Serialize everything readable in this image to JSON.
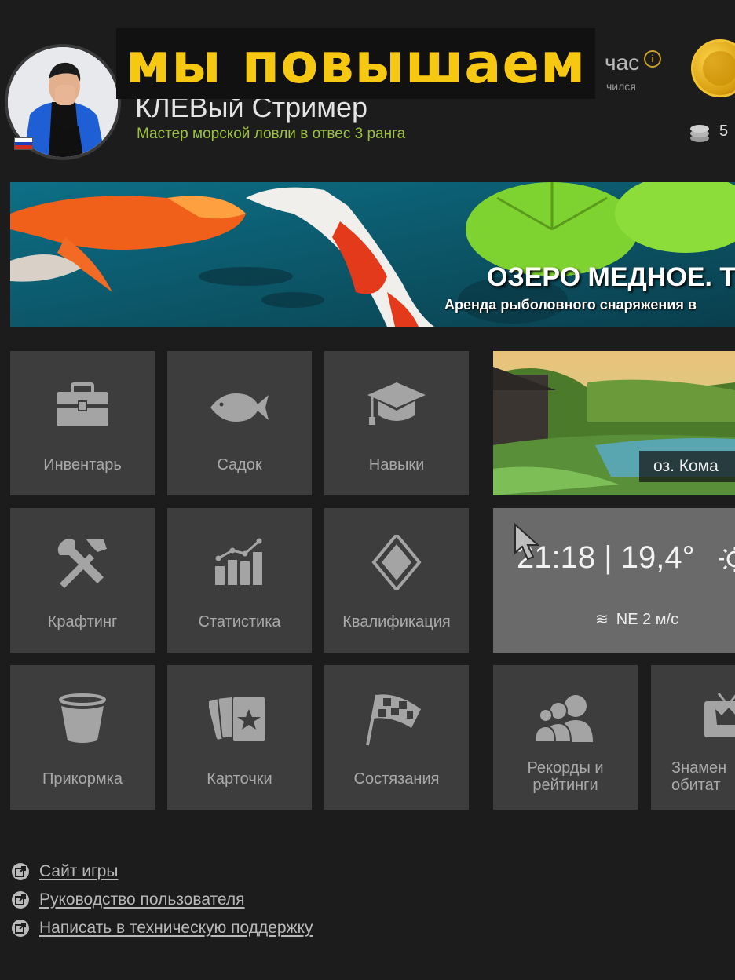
{
  "overlay": {
    "caption": "мы повышаем"
  },
  "header": {
    "status_text": "час",
    "status_subtext": "чился",
    "player": {
      "name": "КЛЕВый Стример",
      "rank": "Мастер морской ловли в отвес 3 ранга",
      "country_flag": [
        "#ffffff",
        "#1d3fbf",
        "#d52b1e"
      ]
    },
    "currency": {
      "gold_icon": "gold-coin-icon",
      "silver_icon": "silver-coins-icon",
      "silver_amount": "5"
    }
  },
  "banner": {
    "title": "ОЗЕРО МЕДНОЕ. Т",
    "subtitle": "Аренда рыболовного снаряжения в"
  },
  "menu": {
    "tiles": [
      {
        "label": "Инвентарь",
        "icon": "toolbox-icon"
      },
      {
        "label": "Садок",
        "icon": "fish-icon"
      },
      {
        "label": "Навыки",
        "icon": "graduation-cap-icon"
      },
      {
        "label": "Крафтинг",
        "icon": "tools-icon"
      },
      {
        "label": "Статистика",
        "icon": "bar-chart-icon"
      },
      {
        "label": "Квалификация",
        "icon": "diamond-icon"
      },
      {
        "label": "Прикормка",
        "icon": "bucket-icon"
      },
      {
        "label": "Карточки",
        "icon": "cards-icon"
      },
      {
        "label": "Состязания",
        "icon": "checkered-flag-icon"
      },
      {
        "label": "Рекорды и рейтинги",
        "icon": "people-icon"
      },
      {
        "label": "Знамен обитат",
        "icon": "tv-trophy-icon"
      }
    ]
  },
  "location": {
    "name": "оз. Кома"
  },
  "weather": {
    "time": "21:18",
    "temperature": "19,4°",
    "wind_direction": "NE",
    "wind_speed": "2 м/с"
  },
  "footer": {
    "links": [
      {
        "label": "Сайт игры"
      },
      {
        "label": "Руководство пользователя"
      },
      {
        "label": "Написать в техническую поддержку"
      }
    ]
  }
}
